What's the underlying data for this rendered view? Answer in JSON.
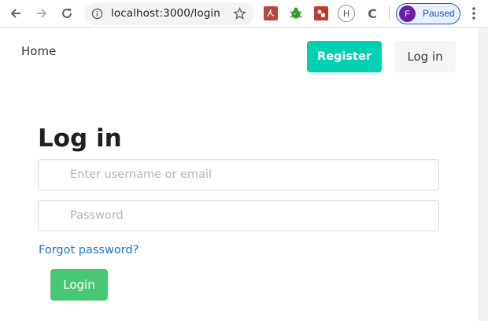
{
  "browser": {
    "url": "localhost:3000/login",
    "profile_initial": "F",
    "profile_status": "Paused",
    "extension_h_label": "H",
    "extension_c_label": "C"
  },
  "nav": {
    "home_label": "Home",
    "register_label": "Register",
    "login_label": "Log in"
  },
  "form": {
    "title": "Log in",
    "username_placeholder": "Enter username or email",
    "username_value": "",
    "password_placeholder": "Password",
    "password_value": "",
    "forgot_label": "Forgot password?",
    "submit_label": "Login"
  },
  "colors": {
    "register_bg": "#00d1b2",
    "submit_bg": "#48c774",
    "link": "#1a73c8",
    "profile_avatar": "#6a1fa7",
    "profile_accent": "#1a56c9"
  }
}
